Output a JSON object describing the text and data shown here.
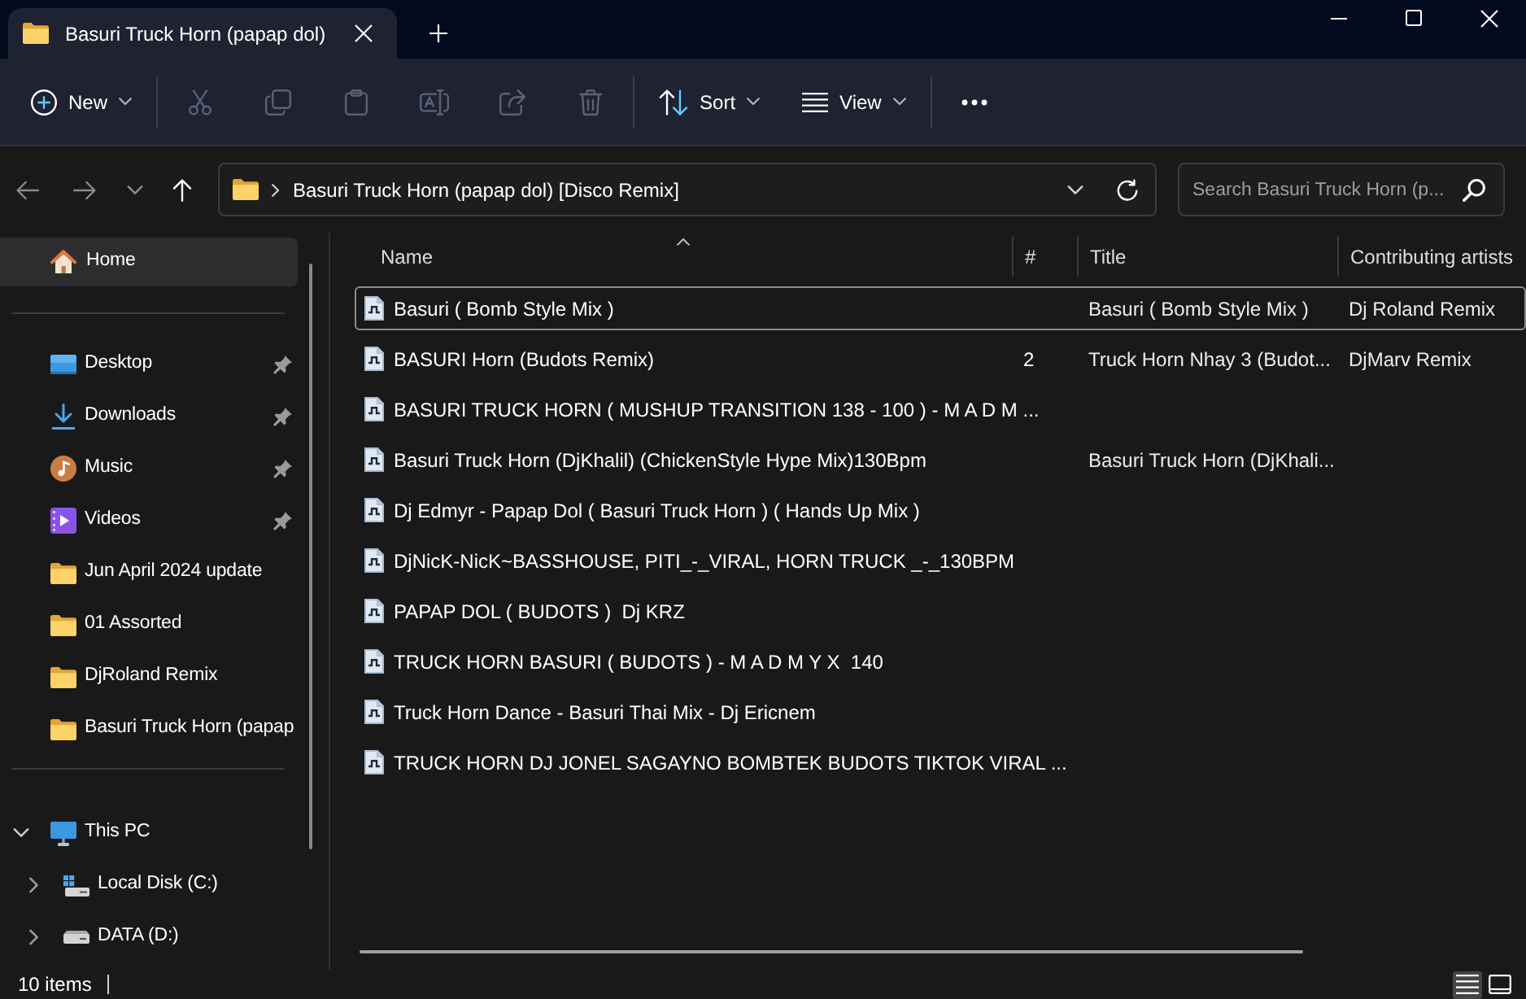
{
  "window": {
    "tabs": [
      {
        "title": "Basuri Truck Horn (papap dol)",
        "selected": true
      }
    ]
  },
  "toolbar": {
    "groups": [
      [
        {
          "kind": "new",
          "label": "New",
          "dropdown": true,
          "disabled": false
        }
      ],
      [
        {
          "kind": "cut",
          "disabled": true
        },
        {
          "kind": "copy",
          "disabled": true
        },
        {
          "kind": "paste",
          "disabled": true
        },
        {
          "kind": "rename",
          "disabled": true
        },
        {
          "kind": "share",
          "disabled": true
        },
        {
          "kind": "delete",
          "disabled": true
        }
      ],
      [
        {
          "kind": "sort",
          "label": "Sort",
          "dropdown": true,
          "disabled": false
        },
        {
          "kind": "view",
          "label": "View",
          "dropdown": true,
          "disabled": false
        }
      ],
      [
        {
          "kind": "more",
          "disabled": false
        }
      ]
    ]
  },
  "navigation": [
    {
      "kind": "back",
      "disabled": true
    },
    {
      "kind": "forward",
      "disabled": true
    },
    {
      "kind": "recent",
      "disabled": true
    },
    {
      "kind": "up",
      "disabled": false
    }
  ],
  "address_bar": {
    "segments": [
      "Basuri Truck Horn (papap dol) [Disco Remix]"
    ]
  },
  "search": {
    "placeholder": "Search Basuri Truck Horn (p..."
  },
  "sidebar": {
    "home": [
      {
        "kind": "home",
        "label": "Home",
        "selected": true
      }
    ],
    "quick_access": [
      {
        "kind": "desktop",
        "label": "Desktop",
        "pinned": true,
        "selected": false
      },
      {
        "kind": "downloads",
        "label": "Downloads",
        "pinned": true,
        "selected": false
      },
      {
        "kind": "music",
        "label": "Music",
        "pinned": true,
        "selected": false
      },
      {
        "kind": "videos",
        "label": "Videos",
        "pinned": true,
        "selected": false
      },
      {
        "kind": "folder",
        "label": "Jun April 2024 update",
        "pinned": false,
        "selected": false
      },
      {
        "kind": "folder",
        "label": "01 Assorted",
        "pinned": false,
        "selected": false
      },
      {
        "kind": "folder",
        "label": "DjRoland Remix",
        "pinned": false,
        "selected": false
      },
      {
        "kind": "folder",
        "label": "Basuri Truck Horn (papap",
        "pinned": false,
        "selected": false
      }
    ],
    "tree": [
      {
        "kind": "pc",
        "label": "This PC",
        "expanded": true,
        "selected": false,
        "children": [
          {
            "kind": "system-drive",
            "label": "Local Disk (C:)",
            "expanded": false,
            "selected": false
          },
          {
            "kind": "drive",
            "label": "DATA (D:)",
            "expanded": false,
            "selected": false
          }
        ]
      }
    ]
  },
  "file_list": {
    "columns": [
      {
        "label": "Name",
        "sorted": true
      },
      {
        "label": "#",
        "sorted": false
      },
      {
        "label": "Title",
        "sorted": false
      },
      {
        "label": "Contributing artists",
        "sorted": false
      }
    ],
    "rows": [
      {
        "name": "Basuri ( Bomb Style Mix )",
        "title": "Basuri ( Bomb Style Mix )",
        "artists": "Dj Roland Remix",
        "focused": true
      },
      {
        "name": "BASURI Horn (Budots Remix)",
        "number": "2",
        "title": "Truck Horn Nhay 3 (Budot...",
        "artists": "DjMarv Remix",
        "focused": false
      },
      {
        "name": "BASURI TRUCK HORN ( MUSHUP TRANSITION 138 - 100 ) - M A D M ...",
        "focused": false
      },
      {
        "name": "Basuri Truck Horn (DjKhalil) (ChickenStyle Hype Mix)130Bpm",
        "title": "Basuri Truck Horn (DjKhali...",
        "focused": false
      },
      {
        "name": "Dj Edmyr - Papap Dol ( Basuri Truck Horn ) ( Hands Up Mix )",
        "focused": false
      },
      {
        "name": "DjNicK-NicK~BASSHOUSE, PITI_-_VIRAL, HORN TRUCK _-_130BPM",
        "focused": false
      },
      {
        "name": "PAPAP DOL ( BUDOTS )  Dj KRZ",
        "focused": false
      },
      {
        "name": "TRUCK HORN BASURI ( BUDOTS ) - M A D M Y X  140",
        "focused": false
      },
      {
        "name": "Truck Horn Dance - Basuri Thai Mix - Dj Ericnem",
        "focused": false
      },
      {
        "name": "TRUCK HORN DJ JONEL SAGAYNO BOMBTEK BUDOTS TIKTOK VIRAL ...",
        "focused": false
      }
    ]
  },
  "status_bar": {
    "item_count": "10 items",
    "views": [
      {
        "kind": "details",
        "selected": true
      },
      {
        "kind": "tiles",
        "selected": false
      }
    ]
  }
}
